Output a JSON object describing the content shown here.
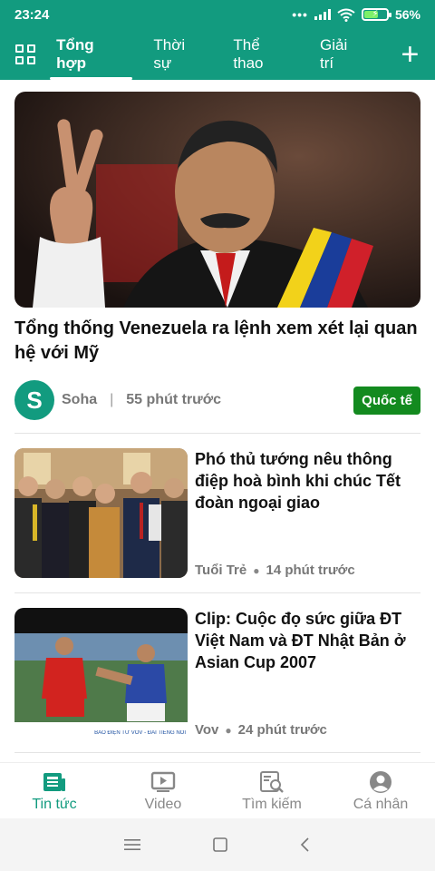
{
  "status_bar": {
    "time": "23:24",
    "battery": "56%",
    "battery_level": 0.56
  },
  "tabs": [
    {
      "label": "Tổng hợp",
      "active": true
    },
    {
      "label": "Thời sự",
      "active": false
    },
    {
      "label": "Thể thao",
      "active": false
    },
    {
      "label": "Giải trí",
      "active": false
    }
  ],
  "hero": {
    "title": "Tổng thống Venezuela ra lệnh xem xét lại quan hệ với Mỹ",
    "avatar_letter": "S",
    "source": "Soha",
    "separator": "|",
    "time": "55 phút trước",
    "category": "Quốc tế"
  },
  "articles": [
    {
      "title": "Phó thủ tướng nêu thông điệp hoà bình khi chúc Tết đoàn ngoại giao",
      "source": "Tuổi Trẻ",
      "time": "14 phút trước"
    },
    {
      "title": "Clip: Cuộc đọ sức giữa ĐT Việt Nam và ĐT Nhật Bản ở Asian Cup 2007",
      "source": "Vov",
      "time": "24 phút trước",
      "image_caption": "BÁO ĐIỆN TỬ VOV - ĐÀI TIẾNG NÓI"
    }
  ],
  "bottom_nav": [
    {
      "label": "Tin tức",
      "icon": "news-icon",
      "active": true
    },
    {
      "label": "Video",
      "icon": "video-icon",
      "active": false
    },
    {
      "label": "Tìm kiếm",
      "icon": "search-icon",
      "active": false
    },
    {
      "label": "Cá nhân",
      "icon": "profile-icon",
      "active": false
    }
  ],
  "colors": {
    "brand": "#129b7f",
    "badge": "#138a1f",
    "meta_text": "#777777"
  }
}
